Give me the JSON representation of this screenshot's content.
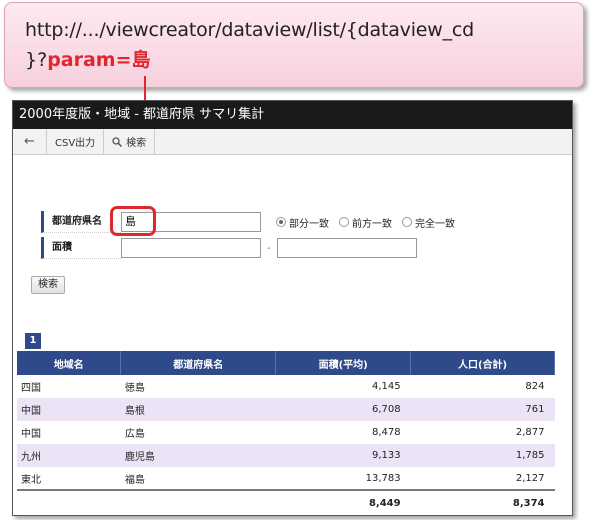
{
  "callout": {
    "url_line1": "http://.../viewcreator/dataview/list/{dataview_cd",
    "url_line2_prefix": "}?",
    "url_line2_param": "param=島"
  },
  "window": {
    "title": "2000年度版・地域 - 都道府県  サマリ集計",
    "toolbar": {
      "back_icon": "←",
      "csv_label": "CSV出力",
      "search_label": "検索"
    }
  },
  "form": {
    "prefecture_label": "都道府県名",
    "prefecture_value": "島",
    "match_options": [
      "部分一致",
      "前方一致",
      "完全一致"
    ],
    "area_label": "面積",
    "range_sep": "-",
    "search_button": "検索"
  },
  "pager": {
    "current_page": "1"
  },
  "table": {
    "headers": [
      "地域名",
      "都道府県名",
      "面積(平均)",
      "人口(合計)"
    ],
    "rows": [
      [
        "四国",
        "徳島",
        "4,145",
        "824"
      ],
      [
        "中国",
        "島根",
        "6,708",
        "761"
      ],
      [
        "中国",
        "広島",
        "8,478",
        "2,877"
      ],
      [
        "九州",
        "鹿児島",
        "9,133",
        "1,785"
      ],
      [
        "東北",
        "福島",
        "13,783",
        "2,127"
      ]
    ],
    "totals": [
      "",
      "",
      "8,449",
      "8,374"
    ]
  },
  "colors": {
    "accent": "#2e4a8a",
    "highlight": "#e0262e",
    "alt_row": "#ece4f6"
  }
}
